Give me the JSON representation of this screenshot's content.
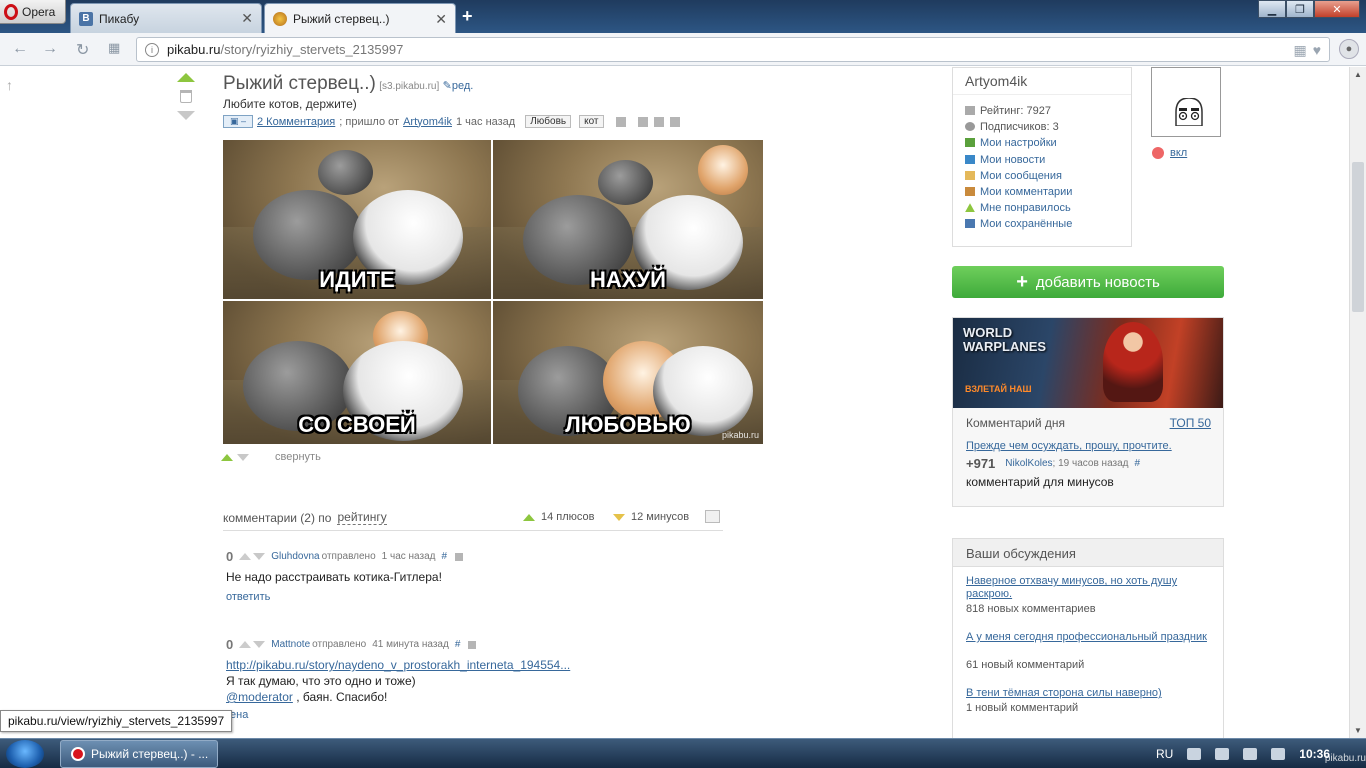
{
  "browser": {
    "menu_label": "Opera",
    "tabs": [
      {
        "title": "Пикабу",
        "active": false
      },
      {
        "title": "Рыжий стервец..)",
        "active": true
      }
    ],
    "url_host": "pikabu.ru",
    "url_path": "/story/ryizhiy_stervets_2135997"
  },
  "story": {
    "title": "Рыжий стервец..)",
    "source": "[s3.pikabu.ru]",
    "edit": "ред.",
    "description": "Любите котов, держите)",
    "comments_link": "2 Комментария",
    "posted_text": "; пришло от",
    "author": "Artyom4ik",
    "time": "1 час назад",
    "tags": [
      "Любовь",
      "кот"
    ],
    "images": [
      {
        "caption": "ИДИТЕ"
      },
      {
        "caption": "НАХУЙ"
      },
      {
        "caption": "СО СВОЕЙ"
      },
      {
        "caption": "ЛЮБОВЬЮ"
      }
    ],
    "watermark": "pikabu.ru",
    "collapse": "свернуть"
  },
  "comments_header": {
    "label": "комментарии (2) по",
    "sort": "рейтингу",
    "plus": "14 плюсов",
    "minus": "12 минусов"
  },
  "comments": [
    {
      "score": "0",
      "author": "Gluhdovna",
      "sent": "отправлено",
      "time": "1 час назад",
      "hash": "#",
      "lines": [
        "Не надо расстраивать котика-Гитлера!"
      ],
      "reply": "ответить"
    },
    {
      "score": "0",
      "author": "Mattnote",
      "sent": "отправлено",
      "time": "41 минута назад",
      "hash": "#",
      "link": "http://pikabu.ru/story/naydeno_v_prostorakh_interneta_194554...",
      "lines": [
        "Я так думаю, что это одно и тоже)"
      ],
      "mention": "@moderator",
      "mention_rest": ", баян. Спасибо!",
      "reply": "ена"
    }
  ],
  "status_url": "pikabu.ru/view/ryizhiy_stervets_2135997",
  "user": {
    "name": "Artyom4ik",
    "rating": "Рейтинг: 7927",
    "subscribers": "Подписчиков: 3",
    "links": [
      "Мои настройки",
      "Мои новости",
      "Мои сообщения",
      "Мои комментарии",
      "Мне понравилось",
      "Мои сохранённые"
    ],
    "toggle": "вкл"
  },
  "add_news": "добавить новость",
  "ad": {
    "logo_line1": "WORLD",
    "logo_line2": "WARPLANES",
    "sub": "ВЗЛЕТАЙ НАШ"
  },
  "comment_of_day": {
    "title": "Комментарий дня",
    "top": "ТОП 50",
    "link": "Прежде чем осуждать, прошу, прочтите.",
    "score": "+971",
    "author": "NikolKoles",
    "time": "; 19 часов назад",
    "hash": "#",
    "text": "комментарий для минусов"
  },
  "discussions": {
    "title": "Ваши обсуждения",
    "items": [
      {
        "title": "Наверное отхвачу минусов, но хоть душу раскрою.",
        "count": "818 новых комментариев"
      },
      {
        "title": "А у меня сегодня профессиональный праздник",
        "count": "61 новый комментарий"
      },
      {
        "title": "В тени тёмная сторона силы наверно)",
        "count": "1 новый комментарий"
      }
    ]
  },
  "taskbar": {
    "window_title": "Рыжий стервец..) - ...",
    "lang": "RU",
    "clock": "10:36",
    "watermark": "pikabu.ru"
  },
  "colors": {
    "link": "#37689b",
    "accent_green": "#3eaa3a",
    "vote_up": "#8dc63f"
  }
}
